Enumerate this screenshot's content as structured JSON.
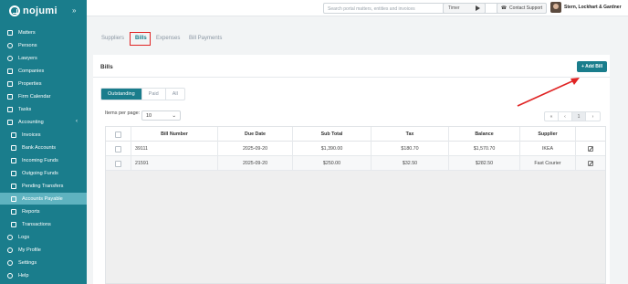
{
  "app": {
    "logo_text": "nojumi"
  },
  "colors": {
    "brand": "#1a7d8c",
    "active_nav": "#5fb3c0",
    "annotation": "#e02424"
  },
  "topbar": {
    "search_placeholder": "Search portal matters, entities and invoices",
    "timer_label": "Timer",
    "support_label": "Contact Support",
    "user_name": "Stern, Lockhart & Gardner"
  },
  "sidebar": {
    "items": [
      {
        "label": "Matters",
        "icon": "briefcase-icon"
      },
      {
        "label": "Persons",
        "icon": "users-icon"
      },
      {
        "label": "Lawyers",
        "icon": "user-icon"
      },
      {
        "label": "Companies",
        "icon": "building-icon"
      },
      {
        "label": "Properties",
        "icon": "home-icon"
      },
      {
        "label": "Firm Calendar",
        "icon": "calendar-icon"
      },
      {
        "label": "Tasks",
        "icon": "checkbox-icon"
      },
      {
        "label": "Accounting",
        "icon": "ledger-icon"
      },
      {
        "label": "Invoices",
        "icon": "invoice-icon"
      },
      {
        "label": "Bank Accounts",
        "icon": "bank-icon"
      },
      {
        "label": "Incoming Funds",
        "icon": "arrow-in-icon"
      },
      {
        "label": "Outgoing Funds",
        "icon": "arrow-out-icon"
      },
      {
        "label": "Pending Transfers",
        "icon": "transfer-icon"
      },
      {
        "label": "Accounts Payable",
        "icon": "document-icon"
      },
      {
        "label": "Reports",
        "icon": "report-icon"
      },
      {
        "label": "Transactions",
        "icon": "transactions-icon"
      },
      {
        "label": "Logs",
        "icon": "logs-icon"
      },
      {
        "label": "My Profile",
        "icon": "profile-icon"
      },
      {
        "label": "Settings",
        "icon": "gear-icon"
      },
      {
        "label": "Help",
        "icon": "help-icon"
      }
    ]
  },
  "tabs": [
    "Suppliers",
    "Bills",
    "Expenses",
    "Bill Payments"
  ],
  "bills": {
    "title": "Bills",
    "add_label": "+ Add Bill",
    "filters": [
      "Outstanding",
      "Paid",
      "All"
    ],
    "items_per_page_label": "Items per page:",
    "items_per_page_value": "10",
    "pager": [
      "«",
      "‹",
      "1",
      "›"
    ],
    "columns": [
      "",
      "Bill Number",
      "Due Date",
      "Sub Total",
      "Tax",
      "Balance",
      "Supplier",
      ""
    ],
    "rows": [
      {
        "bill_number": "39111",
        "due_date": "2025-09-20",
        "sub_total": "$1,390.00",
        "tax": "$180.70",
        "balance": "$1,570.70",
        "supplier": "IKEA"
      },
      {
        "bill_number": "21591",
        "due_date": "2025-09-20",
        "sub_total": "$250.00",
        "tax": "$32.50",
        "balance": "$282.50",
        "supplier": "Fast Courier"
      }
    ]
  }
}
